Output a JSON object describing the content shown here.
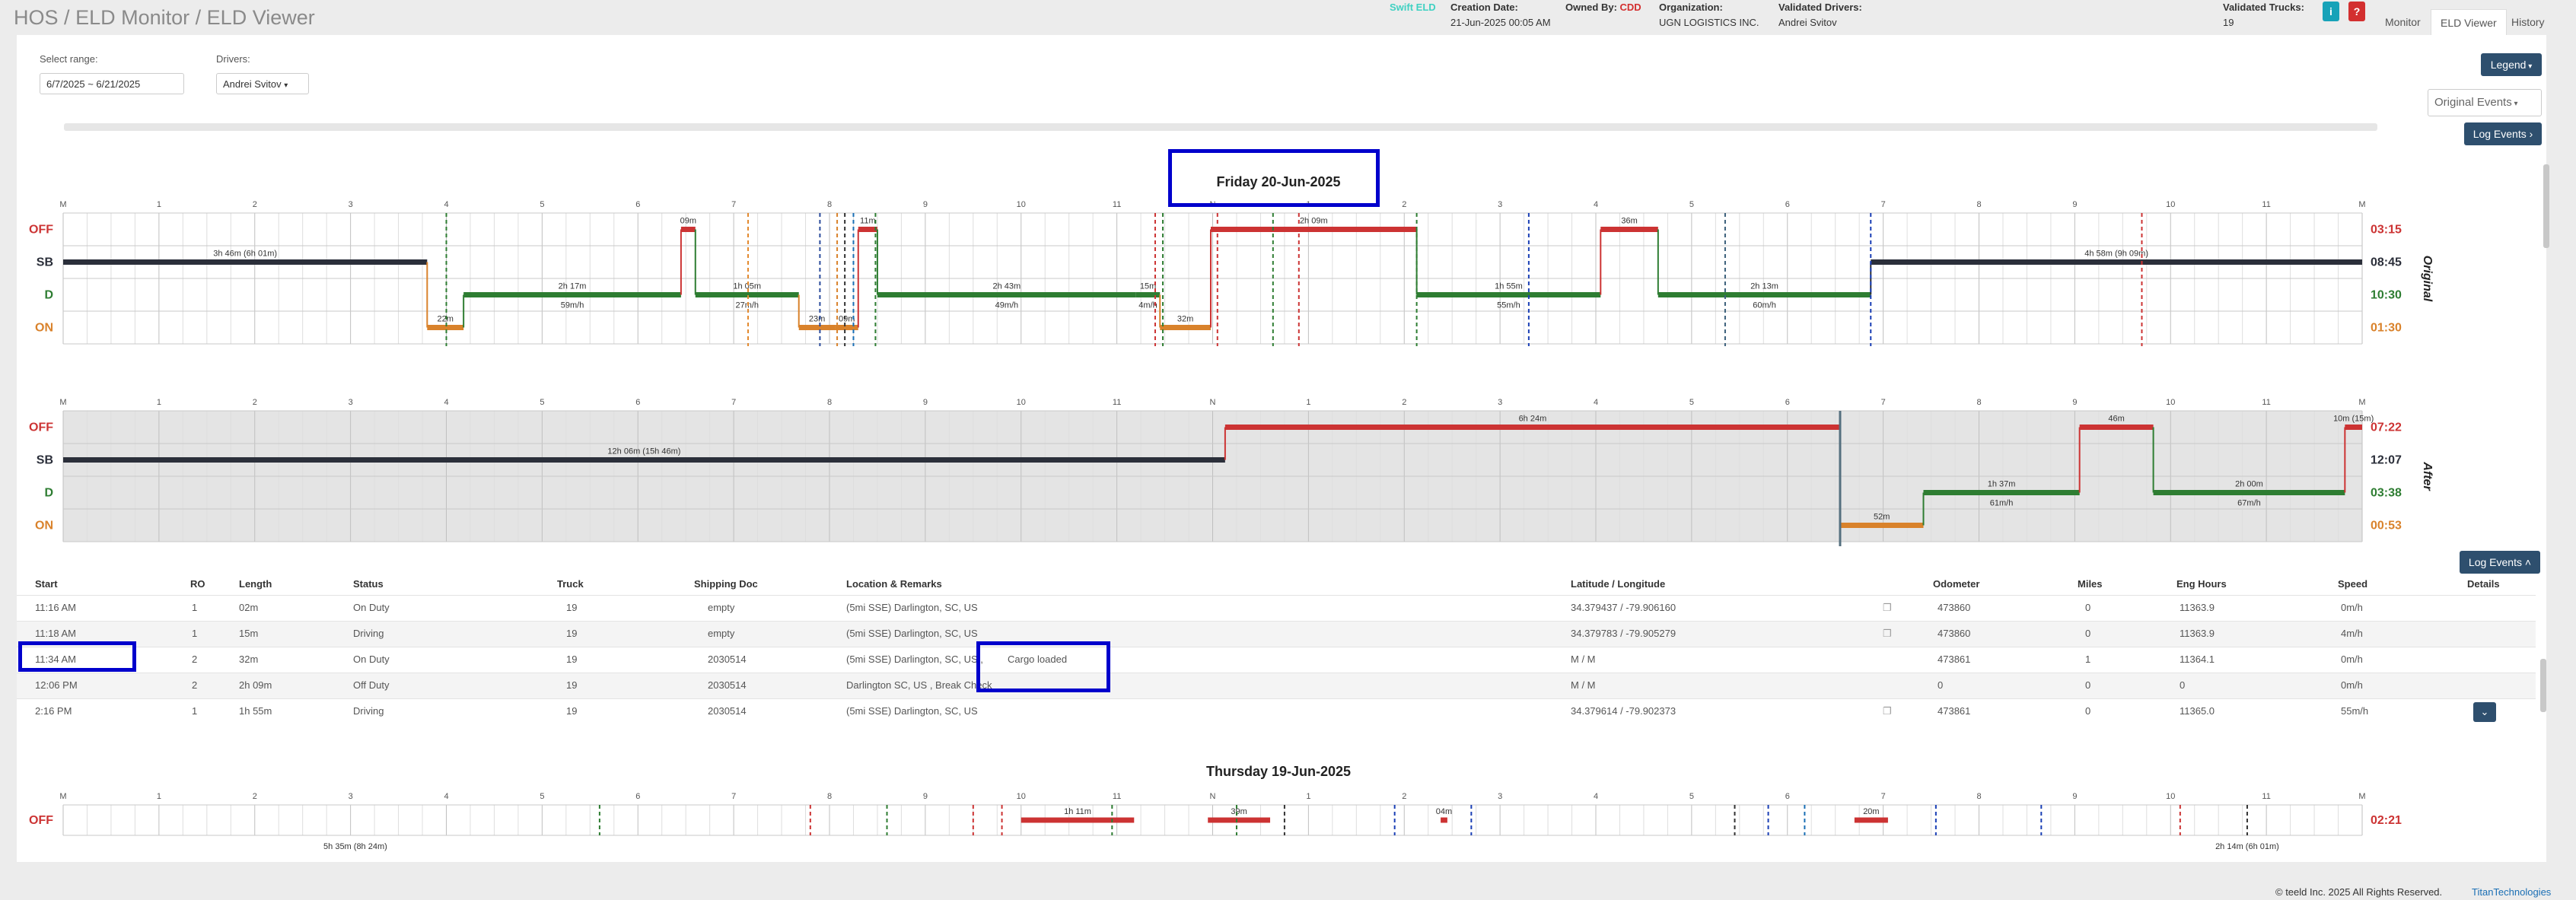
{
  "breadcrumb": {
    "hos": "HOS",
    "monitor": "ELD Monitor",
    "viewer": "ELD Viewer",
    "sep": "/"
  },
  "header": {
    "eld_brand": "Swift ELD",
    "creation_date_label": "Creation Date:",
    "creation_date": "21-Jun-2025 00:05 AM",
    "owned_by_label": "Owned By:",
    "owned_by": "CDD",
    "org_label": "Organization:",
    "org": "UGN LOGISTICS INC.",
    "validated_drivers_label": "Validated Drivers:",
    "validated_driver": "Andrei Svitov",
    "validated_trucks_label": "Validated Trucks:",
    "validated_trucks": "19",
    "info_icon": "i",
    "help_icon": "?"
  },
  "tabs": [
    {
      "label": "Monitor"
    },
    {
      "label": "ELD Viewer"
    },
    {
      "label": "History"
    }
  ],
  "filters": {
    "range_label": "Select range:",
    "range_value": "6/7/2025 ~ 6/21/2025",
    "drivers_label": "Drivers:",
    "driver_value": "Andrei Svitov",
    "legend_button": "Legend",
    "events_select": "Original Events",
    "log_events_button": "Log Events"
  },
  "chart_data": [
    {
      "type": "gantt",
      "title": "Friday 20-Jun-2025",
      "side_label": "Original",
      "hour_ticks": [
        "M",
        "1",
        "2",
        "3",
        "4",
        "5",
        "6",
        "7",
        "8",
        "9",
        "10",
        "11",
        "N",
        "1",
        "2",
        "3",
        "4",
        "5",
        "6",
        "7",
        "8",
        "9",
        "10",
        "11",
        "M"
      ],
      "statuses": [
        "OFF",
        "SB",
        "D",
        "ON"
      ],
      "totals": {
        "OFF": "03:15",
        "SB": "08:45",
        "D": "10:30",
        "ON": "01:30"
      },
      "segments": [
        {
          "status": "SB",
          "start": 0.0,
          "end": 3.8,
          "label": "3h 46m (6h 01m)"
        },
        {
          "status": "ON",
          "start": 3.8,
          "end": 4.18,
          "label": "22m"
        },
        {
          "status": "D",
          "start": 4.18,
          "end": 6.45,
          "label": "2h 17m",
          "sublabel": "59m/h"
        },
        {
          "status": "OFF",
          "start": 6.45,
          "end": 6.6,
          "label": "09m"
        },
        {
          "status": "D",
          "start": 6.6,
          "end": 7.68,
          "label": "1h 05m",
          "sublabel": "27m/h"
        },
        {
          "status": "ON",
          "start": 7.68,
          "end": 8.06,
          "label": "23m"
        },
        {
          "status": "ON",
          "start": 8.06,
          "end": 8.3,
          "label": "09m"
        },
        {
          "status": "OFF",
          "start": 8.3,
          "end": 8.5,
          "label": "11m"
        },
        {
          "status": "D",
          "start": 8.5,
          "end": 11.2,
          "label": "2h 43m",
          "sublabel": "49m/h"
        },
        {
          "status": "D",
          "start": 11.2,
          "end": 11.45,
          "label": "15m",
          "sublabel": "4m/h"
        },
        {
          "status": "ON",
          "start": 11.45,
          "end": 11.98,
          "label": "32m"
        },
        {
          "status": "OFF",
          "start": 11.98,
          "end": 14.13,
          "label": "2h 09m"
        },
        {
          "status": "D",
          "start": 14.13,
          "end": 16.05,
          "label": "1h 55m",
          "sublabel": "55m/h"
        },
        {
          "status": "OFF",
          "start": 16.05,
          "end": 16.65,
          "label": "36m"
        },
        {
          "status": "D",
          "start": 16.65,
          "end": 18.87,
          "label": "2h 13m",
          "sublabel": "60m/h"
        },
        {
          "status": "SB",
          "start": 18.87,
          "end": 24.0,
          "label": "4h 58m (9h 09m)"
        }
      ]
    },
    {
      "type": "gantt",
      "title": "",
      "side_label": "After",
      "hour_ticks": [
        "M",
        "1",
        "2",
        "3",
        "4",
        "5",
        "6",
        "7",
        "8",
        "9",
        "10",
        "11",
        "N",
        "1",
        "2",
        "3",
        "4",
        "5",
        "6",
        "7",
        "8",
        "9",
        "10",
        "11",
        "M"
      ],
      "statuses": [
        "OFF",
        "SB",
        "D",
        "ON"
      ],
      "totals": {
        "OFF": "07:22",
        "SB": "12:07",
        "D": "03:38",
        "ON": "00:53"
      },
      "segments": [
        {
          "status": "SB",
          "start": 0.0,
          "end": 12.13,
          "label": "12h 06m (15h 46m)"
        },
        {
          "status": "OFF",
          "start": 12.13,
          "end": 18.55,
          "label": "6h 24m"
        },
        {
          "status": "ON",
          "start": 18.55,
          "end": 19.42,
          "label": "52m"
        },
        {
          "status": "D",
          "start": 19.42,
          "end": 21.05,
          "label": "1h 37m",
          "sublabel": "61m/h"
        },
        {
          "status": "OFF",
          "start": 21.05,
          "end": 21.82,
          "label": "46m"
        },
        {
          "status": "D",
          "start": 21.82,
          "end": 23.82,
          "label": "2h 00m",
          "sublabel": "67m/h"
        },
        {
          "status": "OFF",
          "start": 23.82,
          "end": 24.0,
          "label": "10m (15m)"
        }
      ]
    },
    {
      "type": "gantt",
      "title": "Thursday 19-Jun-2025",
      "side_label": "",
      "hour_ticks": [
        "M",
        "1",
        "2",
        "3",
        "4",
        "5",
        "6",
        "7",
        "8",
        "9",
        "10",
        "11",
        "N",
        "1",
        "2",
        "3",
        "4",
        "5",
        "6",
        "7",
        "8",
        "9",
        "10",
        "11",
        "M"
      ],
      "statuses": [
        "OFF"
      ],
      "totals": {
        "OFF": "02:21"
      },
      "segments": [
        {
          "status": "OFF",
          "start": 10.0,
          "end": 11.18,
          "label": "1h 11m"
        },
        {
          "status": "OFF",
          "start": 11.95,
          "end": 12.6,
          "label": "39m"
        },
        {
          "status": "OFF",
          "start": 14.38,
          "end": 14.45,
          "label": "04m"
        },
        {
          "status": "OFF",
          "start": 18.7,
          "end": 19.05,
          "label": "20m"
        }
      ],
      "extra_labels": [
        "5h 35m (8h 24m)",
        "2h 14m (6h 01m)"
      ]
    }
  ],
  "table": {
    "columns": [
      "Start",
      "RO",
      "Length",
      "Status",
      "Truck",
      "Shipping Doc",
      "Location & Remarks",
      "Latitude / Longitude",
      "Odometer",
      "Miles",
      "Eng Hours",
      "Speed",
      "Details"
    ],
    "rows": [
      {
        "start": "11:16 AM",
        "ro": "1",
        "length": "02m",
        "status": "On Duty",
        "truck": "19",
        "doc": "empty",
        "loc": "(5mi SSE) Darlington, SC, US",
        "remark": "",
        "latlng": "34.379437 / -79.906160",
        "odometer": "473860",
        "miles": "0",
        "eng": "11363.9",
        "speed": "0m/h"
      },
      {
        "start": "11:18 AM",
        "ro": "1",
        "length": "15m",
        "status": "Driving",
        "truck": "19",
        "doc": "empty",
        "loc": "(5mi SSE) Darlington, SC, US",
        "remark": "",
        "latlng": "34.379783 / -79.905279",
        "odometer": "473860",
        "miles": "0",
        "eng": "11363.9",
        "speed": "4m/h"
      },
      {
        "start": "11:34 AM",
        "ro": "2",
        "length": "32m",
        "status": "On Duty",
        "truck": "19",
        "doc": "2030514",
        "loc": "(5mi SSE) Darlington, SC, US ,",
        "remark": "Cargo loaded",
        "latlng": "M / M",
        "odometer": "473861",
        "miles": "1",
        "eng": "11364.1",
        "speed": "0m/h"
      },
      {
        "start": "12:06 PM",
        "ro": "2",
        "length": "2h 09m",
        "status": "Off Duty",
        "truck": "19",
        "doc": "2030514",
        "loc": "Darlington SC, US , Break Check",
        "remark": "",
        "latlng": "M / M",
        "odometer": "0",
        "miles": "0",
        "eng": "0",
        "speed": "0m/h"
      },
      {
        "start": "2:16 PM",
        "ro": "1",
        "length": "1h 55m",
        "status": "Driving",
        "truck": "19",
        "doc": "2030514",
        "loc": "(5mi SSE) Darlington, SC, US",
        "remark": "",
        "latlng": "34.379614 / -79.902373",
        "odometer": "473861",
        "miles": "0",
        "eng": "11365.0",
        "speed": "55m/h"
      }
    ]
  },
  "footer": {
    "copyright": "© teeld Inc. 2025 All Rights Reserved.",
    "brand": "TitanTechnologies"
  },
  "colors": {
    "off": "#cc3333",
    "sb": "#2b2f3a",
    "d": "#2e7d32",
    "on": "#d9822b",
    "highlight": "#0000cc",
    "accent": "#2e4f6e"
  }
}
